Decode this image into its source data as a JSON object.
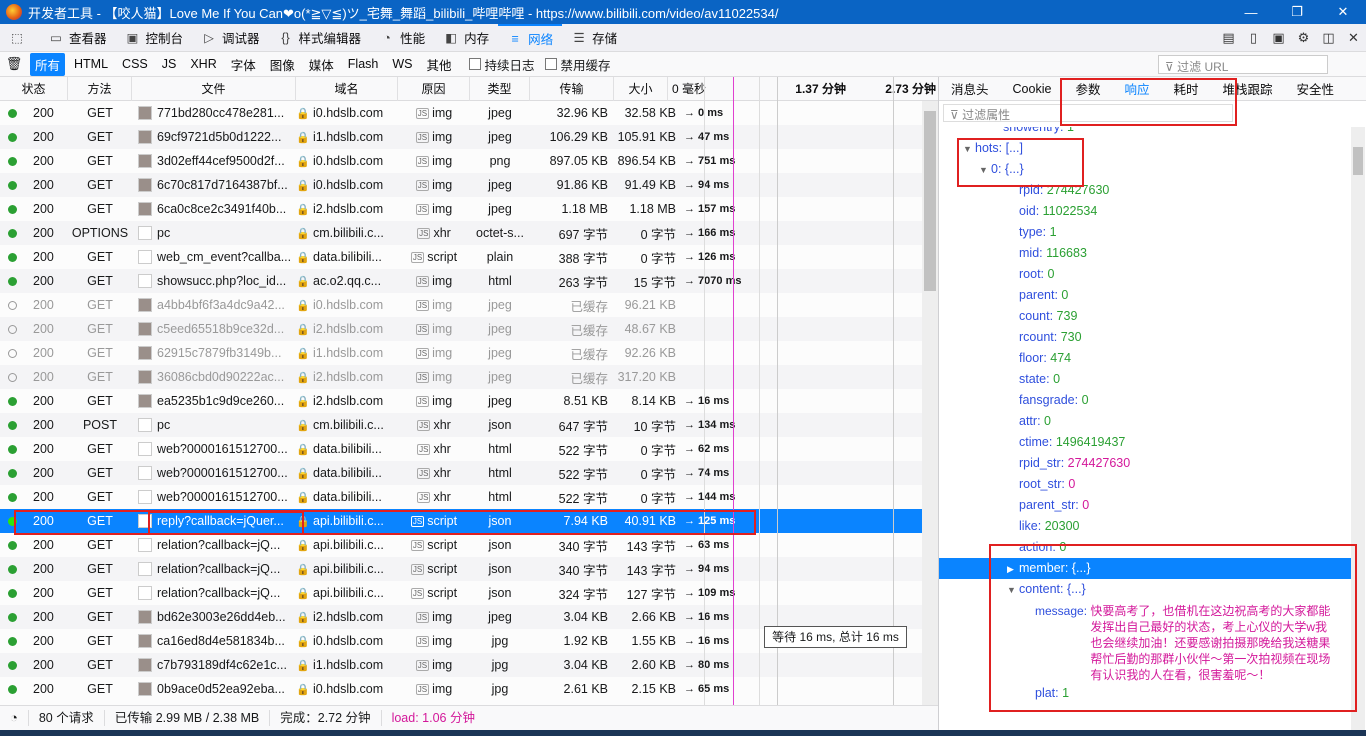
{
  "window": {
    "title": "开发者工具 - 【咬人猫】Love Me If You Can❤o(*≧▽≦)ツ_宅舞_舞蹈_bilibili_哔哩哔哩 - https://www.bilibili.com/video/av11022534/",
    "min_icon": "minimize-icon",
    "max_icon": "maximize-icon",
    "close_icon": "close-icon"
  },
  "toolbar": {
    "tabs": [
      {
        "label": "查看器",
        "icon": "inspector-icon"
      },
      {
        "label": "控制台",
        "icon": "console-icon"
      },
      {
        "label": "调试器",
        "icon": "debugger-icon"
      },
      {
        "label": "样式编辑器",
        "icon": "style-editor-icon"
      },
      {
        "label": "性能",
        "icon": "performance-icon"
      },
      {
        "label": "内存",
        "icon": "memory-icon"
      },
      {
        "label": "网络",
        "icon": "network-icon"
      },
      {
        "label": "存储",
        "icon": "storage-icon"
      }
    ]
  },
  "filterbar": {
    "types": [
      "所有",
      "HTML",
      "CSS",
      "JS",
      "XHR",
      "字体",
      "图像",
      "媒体",
      "Flash",
      "WS",
      "其他"
    ],
    "persist_logs": "持续日志",
    "disable_cache": "禁用缓存",
    "url_placeholder": "过滤 URL"
  },
  "columns": {
    "status": "状态",
    "method": "方法",
    "file": "文件",
    "domain": "域名",
    "cause": "原因",
    "type": "类型",
    "transferred": "传输",
    "size": "大小",
    "t0": "0 毫秒",
    "t1": "1.37 分钟",
    "t2": "2.73 分钟"
  },
  "requests": [
    {
      "status": "200",
      "method": "GET",
      "file": "771bd280cc478e281...",
      "domain": "i0.hdslb.com",
      "cause": "img",
      "type": "jpeg",
      "transferred": "32.96 KB",
      "size": "32.58 KB",
      "time": "→ 0 ms",
      "thumb": true,
      "cached": false
    },
    {
      "status": "200",
      "method": "GET",
      "file": "69cf9721d5b0d1222...",
      "domain": "i1.hdslb.com",
      "cause": "img",
      "type": "jpeg",
      "transferred": "106.29 KB",
      "size": "105.91 KB",
      "time": "→ 47 ms",
      "thumb": true,
      "cached": false
    },
    {
      "status": "200",
      "method": "GET",
      "file": "3d02eff44cef9500d2f...",
      "domain": "i0.hdslb.com",
      "cause": "img",
      "type": "png",
      "transferred": "897.05 KB",
      "size": "896.54 KB",
      "time": "→ 751 ms",
      "thumb": true,
      "cached": false
    },
    {
      "status": "200",
      "method": "GET",
      "file": "6c70c817d7164387bf...",
      "domain": "i0.hdslb.com",
      "cause": "img",
      "type": "jpeg",
      "transferred": "91.86 KB",
      "size": "91.49 KB",
      "time": "→ 94 ms",
      "thumb": true,
      "cached": false
    },
    {
      "status": "200",
      "method": "GET",
      "file": "6ca0c8ce2c3491f40b...",
      "domain": "i2.hdslb.com",
      "cause": "img",
      "type": "jpeg",
      "transferred": "1.18 MB",
      "size": "1.18 MB",
      "time": "→ 157 ms",
      "thumb": true,
      "cached": false
    },
    {
      "status": "200",
      "method": "OPTIONS",
      "file": "pc",
      "domain": "cm.bilibili.c...",
      "cause": "xhr",
      "type": "octet-s...",
      "transferred": "697 字节",
      "size": "0 字节",
      "time": "→ 166 ms",
      "thumb": false,
      "cached": false
    },
    {
      "status": "200",
      "method": "GET",
      "file": "web_cm_event?callba...",
      "domain": "data.bilibili...",
      "cause": "script",
      "type": "plain",
      "transferred": "388 字节",
      "size": "0 字节",
      "time": "→ 126 ms",
      "thumb": false,
      "cached": false
    },
    {
      "status": "200",
      "method": "GET",
      "file": "showsucc.php?loc_id...",
      "domain": "ac.o2.qq.c...",
      "cause": "img",
      "type": "html",
      "transferred": "263 字节",
      "size": "15 字节",
      "time": "→ 7070 ms",
      "thumb": false,
      "cached": false
    },
    {
      "status": "200",
      "method": "GET",
      "file": "a4bb4bf6f3a4dc9a42...",
      "domain": "i0.hdslb.com",
      "cause": "img",
      "type": "jpeg",
      "transferred": "已缓存",
      "size": "96.21 KB",
      "time": "",
      "thumb": true,
      "cached": true
    },
    {
      "status": "200",
      "method": "GET",
      "file": "c5eed65518b9ce32d...",
      "domain": "i2.hdslb.com",
      "cause": "img",
      "type": "jpeg",
      "transferred": "已缓存",
      "size": "48.67 KB",
      "time": "",
      "thumb": true,
      "cached": true
    },
    {
      "status": "200",
      "method": "GET",
      "file": "62915c7879fb3149b...",
      "domain": "i1.hdslb.com",
      "cause": "img",
      "type": "jpeg",
      "transferred": "已缓存",
      "size": "92.26 KB",
      "time": "",
      "thumb": true,
      "cached": true
    },
    {
      "status": "200",
      "method": "GET",
      "file": "36086cbd0d90222ac...",
      "domain": "i2.hdslb.com",
      "cause": "img",
      "type": "jpeg",
      "transferred": "已缓存",
      "size": "317.20 KB",
      "time": "",
      "thumb": true,
      "cached": true
    },
    {
      "status": "200",
      "method": "GET",
      "file": "ea5235b1c9d9ce260...",
      "domain": "i2.hdslb.com",
      "cause": "img",
      "type": "jpeg",
      "transferred": "8.51 KB",
      "size": "8.14 KB",
      "time": "→ 16 ms",
      "thumb": true,
      "cached": false
    },
    {
      "status": "200",
      "method": "POST",
      "file": "pc",
      "domain": "cm.bilibili.c...",
      "cause": "xhr",
      "type": "json",
      "transferred": "647 字节",
      "size": "10 字节",
      "time": "→ 134 ms",
      "thumb": false,
      "cached": false
    },
    {
      "status": "200",
      "method": "GET",
      "file": "web?0000161512700...",
      "domain": "data.bilibili...",
      "cause": "xhr",
      "type": "html",
      "transferred": "522 字节",
      "size": "0 字节",
      "time": "→ 62 ms",
      "thumb": false,
      "cached": false
    },
    {
      "status": "200",
      "method": "GET",
      "file": "web?0000161512700...",
      "domain": "data.bilibili...",
      "cause": "xhr",
      "type": "html",
      "transferred": "522 字节",
      "size": "0 字节",
      "time": "→ 74 ms",
      "thumb": false,
      "cached": false
    },
    {
      "status": "200",
      "method": "GET",
      "file": "web?0000161512700...",
      "domain": "data.bilibili...",
      "cause": "xhr",
      "type": "html",
      "transferred": "522 字节",
      "size": "0 字节",
      "time": "→ 144 ms",
      "thumb": false,
      "cached": false
    },
    {
      "status": "200",
      "method": "GET",
      "file": "reply?callback=jQuer...",
      "domain": "api.bilibili.c...",
      "cause": "script",
      "type": "json",
      "transferred": "7.94 KB",
      "size": "40.91 KB",
      "time": "→ 125 ms",
      "thumb": false,
      "cached": false,
      "selected": true
    },
    {
      "status": "200",
      "method": "GET",
      "file": "relation?callback=jQ...",
      "domain": "api.bilibili.c...",
      "cause": "script",
      "type": "json",
      "transferred": "340 字节",
      "size": "143 字节",
      "time": "→ 63 ms",
      "thumb": false,
      "cached": false
    },
    {
      "status": "200",
      "method": "GET",
      "file": "relation?callback=jQ...",
      "domain": "api.bilibili.c...",
      "cause": "script",
      "type": "json",
      "transferred": "340 字节",
      "size": "143 字节",
      "time": "→ 94 ms",
      "thumb": false,
      "cached": false
    },
    {
      "status": "200",
      "method": "GET",
      "file": "relation?callback=jQ...",
      "domain": "api.bilibili.c...",
      "cause": "script",
      "type": "json",
      "transferred": "324 字节",
      "size": "127 字节",
      "time": "→ 109 ms",
      "thumb": false,
      "cached": false
    },
    {
      "status": "200",
      "method": "GET",
      "file": "bd62e3003e26dd4eb...",
      "domain": "i2.hdslb.com",
      "cause": "img",
      "type": "jpeg",
      "transferred": "3.04 KB",
      "size": "2.66 KB",
      "time": "→ 16 ms",
      "thumb": true,
      "cached": false
    },
    {
      "status": "200",
      "method": "GET",
      "file": "ca16ed8d4e581834b...",
      "domain": "i0.hdslb.com",
      "cause": "img",
      "type": "jpg",
      "transferred": "1.92 KB",
      "size": "1.55 KB",
      "time": "→ 16 ms",
      "thumb": true,
      "cached": false
    },
    {
      "status": "200",
      "method": "GET",
      "file": "c7b793189df4c62e1c...",
      "domain": "i1.hdslb.com",
      "cause": "img",
      "type": "jpg",
      "transferred": "3.04 KB",
      "size": "2.60 KB",
      "time": "→ 80 ms",
      "thumb": true,
      "cached": false
    },
    {
      "status": "200",
      "method": "GET",
      "file": "0b9ace0d52ea92eba...",
      "domain": "i0.hdslb.com",
      "cause": "img",
      "type": "jpg",
      "transferred": "2.61 KB",
      "size": "2.15 KB",
      "time": "→ 65 ms",
      "thumb": true,
      "cached": false
    }
  ],
  "tooltip": "等待 16 ms, 总计 16 ms",
  "status": {
    "requests": "80 个请求",
    "transferred": "已传输 2.99 MB / 2.38 MB",
    "finish": "完成：2.72 分钟",
    "load": "load: 1.06 分钟"
  },
  "details": {
    "tabs": [
      "消息头",
      "Cookie",
      "参数",
      "响应",
      "耗时",
      "堆栈跟踪",
      "安全性"
    ],
    "selected_tab": "响应",
    "filter_placeholder": "过滤属性",
    "tree": [
      {
        "key": "showentry",
        "val": "1",
        "vtype": "num",
        "indent": 0
      },
      {
        "key": "hots",
        "val": "[...]",
        "vtype": "obj",
        "indent": 0,
        "arrow": "down"
      },
      {
        "key": "0",
        "val": "{...}",
        "vtype": "obj",
        "indent": 1,
        "arrow": "down"
      },
      {
        "key": "rpid",
        "val": "274427630",
        "vtype": "num",
        "indent": 2
      },
      {
        "key": "oid",
        "val": "11022534",
        "vtype": "num",
        "indent": 2
      },
      {
        "key": "type",
        "val": "1",
        "vtype": "num",
        "indent": 2
      },
      {
        "key": "mid",
        "val": "116683",
        "vtype": "num",
        "indent": 2
      },
      {
        "key": "root",
        "val": "0",
        "vtype": "num",
        "indent": 2
      },
      {
        "key": "parent",
        "val": "0",
        "vtype": "num",
        "indent": 2
      },
      {
        "key": "count",
        "val": "739",
        "vtype": "num",
        "indent": 2
      },
      {
        "key": "rcount",
        "val": "730",
        "vtype": "num",
        "indent": 2
      },
      {
        "key": "floor",
        "val": "474",
        "vtype": "num",
        "indent": 2
      },
      {
        "key": "state",
        "val": "0",
        "vtype": "num",
        "indent": 2
      },
      {
        "key": "fansgrade",
        "val": "0",
        "vtype": "num",
        "indent": 2
      },
      {
        "key": "attr",
        "val": "0",
        "vtype": "num",
        "indent": 2
      },
      {
        "key": "ctime",
        "val": "1496419437",
        "vtype": "num",
        "indent": 2
      },
      {
        "key": "rpid_str",
        "val": "274427630",
        "vtype": "str",
        "indent": 2
      },
      {
        "key": "root_str",
        "val": "0",
        "vtype": "str",
        "indent": 2
      },
      {
        "key": "parent_str",
        "val": "0",
        "vtype": "str",
        "indent": 2
      },
      {
        "key": "like",
        "val": "20300",
        "vtype": "num",
        "indent": 2
      },
      {
        "key": "action",
        "val": "0",
        "vtype": "num",
        "indent": 2
      },
      {
        "key": "member",
        "val": "{...}",
        "vtype": "obj",
        "indent": 2,
        "arrow": "right",
        "selected": true
      },
      {
        "key": "content",
        "val": "{...}",
        "vtype": "obj",
        "indent": 2,
        "arrow": "down"
      }
    ],
    "message_key": "message",
    "message": "快要高考了，也借机在这边祝高考的大家都能发挥出自己最好的状态，考上心仪的大学w我也会继续加油！还要感谢拍摄那晚给我送糖果帮忙后勤的那群小伙伴～第一次拍视频在现场有认识我的人在看，很害羞呢～！",
    "plat_key": "plat",
    "plat_val": "1"
  },
  "colors": {
    "accent": "#0a84ff",
    "highlight": "#e02020",
    "ok": "#2ba033"
  }
}
